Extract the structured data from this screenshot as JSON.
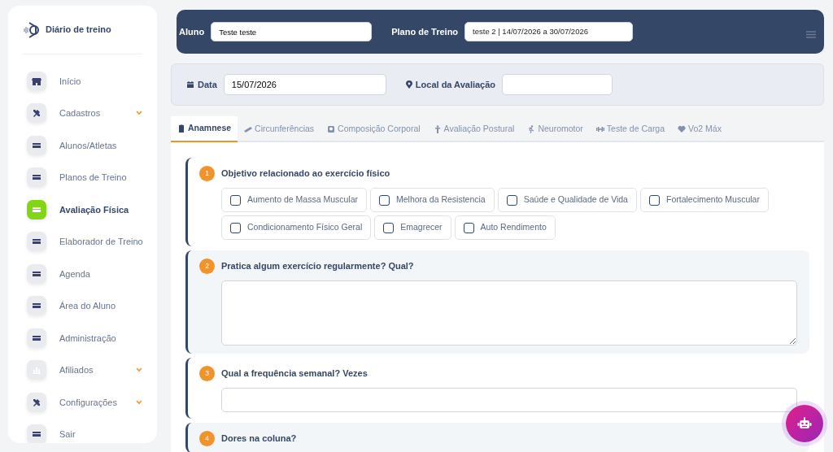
{
  "app": {
    "title": "Diário de treino"
  },
  "sidebar": {
    "items": [
      {
        "label": "Início",
        "kind": "store",
        "selected": false,
        "expandable": false
      },
      {
        "label": "Cadastros",
        "kind": "tools",
        "selected": false,
        "expandable": true
      },
      {
        "label": "Alunos/Atletas",
        "kind": "card",
        "selected": false,
        "expandable": false
      },
      {
        "label": "Planos de Treino",
        "kind": "card",
        "selected": false,
        "expandable": false
      },
      {
        "label": "Avaliação Física",
        "kind": "card",
        "selected": true,
        "expandable": false
      },
      {
        "label": "Elaborador de Treino",
        "kind": "card",
        "selected": false,
        "expandable": false
      },
      {
        "label": "Agenda",
        "kind": "card",
        "selected": false,
        "expandable": false
      },
      {
        "label": "Área do Aluno",
        "kind": "card",
        "selected": false,
        "expandable": false
      },
      {
        "label": "Administração",
        "kind": "card",
        "selected": false,
        "expandable": false
      },
      {
        "label": "Afiliados",
        "kind": "chart",
        "selected": false,
        "expandable": true
      },
      {
        "label": "Configurações",
        "kind": "tools",
        "selected": false,
        "expandable": true
      },
      {
        "label": "Sair",
        "kind": "card",
        "selected": false,
        "expandable": false
      }
    ]
  },
  "header": {
    "student": {
      "label": "Aluno",
      "value": "Teste teste"
    },
    "plan": {
      "label": "Plano de Treino",
      "value": "teste 2 | 14/07/2026 a 30/07/2026"
    }
  },
  "filters": {
    "date": {
      "label": "Data",
      "value": "15/07/2026"
    },
    "location": {
      "label": "Local da Avaliação"
    }
  },
  "tabs": [
    {
      "label": "Anamnese",
      "kind": "clipboard",
      "selected": true
    },
    {
      "label": "Circunferências",
      "kind": "tape",
      "selected": false
    },
    {
      "label": "Composição Corporal",
      "kind": "scale",
      "selected": false
    },
    {
      "label": "Avaliação Postural",
      "kind": "figure",
      "selected": false
    },
    {
      "label": "Neuromotor",
      "kind": "runner",
      "selected": false
    },
    {
      "label": "Teste de Carga",
      "kind": "dumbbell",
      "selected": false
    },
    {
      "label": "Vo2 Máx",
      "kind": "heart",
      "selected": false
    }
  ],
  "questions": [
    {
      "number": "1",
      "text": "Objetivo relacionado ao exercício físico",
      "kind": "checkboxes",
      "options": [
        {
          "label": "Aumento de Massa Muscular",
          "checked": false
        },
        {
          "label": "Melhora da Resistencia",
          "checked": false
        },
        {
          "label": "Saúde e Qualidade de Vida",
          "checked": false
        },
        {
          "label": "Fortalecimento Muscular",
          "checked": false
        },
        {
          "label": "Condicionamento Físico Geral",
          "checked": false
        },
        {
          "label": "Emagrecer",
          "checked": false
        },
        {
          "label": "Auto Rendimento",
          "checked": false
        }
      ]
    },
    {
      "number": "2",
      "text": "Pratica algum exercício regularmente? Qual?",
      "kind": "textarea"
    },
    {
      "number": "3",
      "text": "Qual a frequência semanal? Vezes",
      "kind": "input"
    },
    {
      "number": "4",
      "text": "Dores na coluna?",
      "kind": "none"
    }
  ]
}
